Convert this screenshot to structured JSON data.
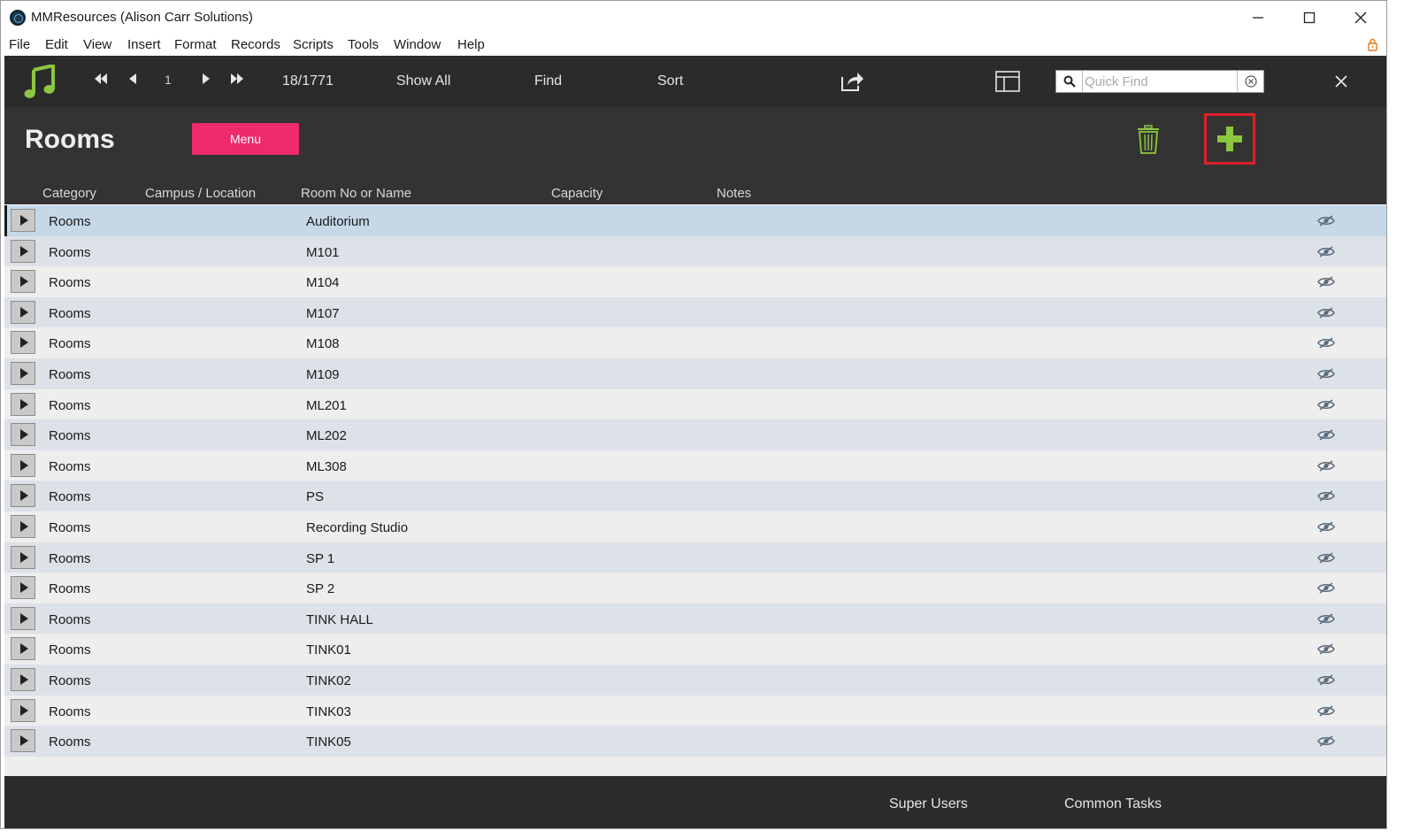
{
  "window": {
    "title": "MMResources (Alison Carr Solutions)"
  },
  "menubar": [
    "File",
    "Edit",
    "View",
    "Insert",
    "Format",
    "Records",
    "Scripts",
    "Tools",
    "Window",
    "Help"
  ],
  "toolbar": {
    "record_number": "1",
    "record_count": "18/1771",
    "show_all": "Show All",
    "find": "Find",
    "sort": "Sort",
    "quick_find_placeholder": "Quick Find"
  },
  "header": {
    "title": "Rooms",
    "menu_button": "Menu",
    "add_highlight_color": "#e0202a",
    "columns": [
      "Category",
      "Campus / Location",
      "Room No or Name",
      "Capacity",
      "Notes"
    ]
  },
  "rows": [
    {
      "category": "Rooms",
      "room": "Auditorium",
      "selected": true
    },
    {
      "category": "Rooms",
      "room": "M101"
    },
    {
      "category": "Rooms",
      "room": "M104"
    },
    {
      "category": "Rooms",
      "room": "M107"
    },
    {
      "category": "Rooms",
      "room": "M108"
    },
    {
      "category": "Rooms",
      "room": "M109"
    },
    {
      "category": "Rooms",
      "room": "ML201"
    },
    {
      "category": "Rooms",
      "room": "ML202"
    },
    {
      "category": "Rooms",
      "room": "ML308"
    },
    {
      "category": "Rooms",
      "room": "PS"
    },
    {
      "category": "Rooms",
      "room": "Recording Studio"
    },
    {
      "category": "Rooms",
      "room": "SP 1"
    },
    {
      "category": "Rooms",
      "room": "SP 2"
    },
    {
      "category": "Rooms",
      "room": "TINK HALL"
    },
    {
      "category": "Rooms",
      "room": "TINK01"
    },
    {
      "category": "Rooms",
      "room": "TINK02"
    },
    {
      "category": "Rooms",
      "room": "TINK03"
    },
    {
      "category": "Rooms",
      "room": "TINK05"
    }
  ],
  "footer": {
    "super_users": "Super Users",
    "common_tasks": "Common Tasks"
  },
  "colors": {
    "menu_button": "#ee2a6b",
    "accent_green": "#8dc63f",
    "toolbar_bg": "#2b2b2b",
    "header_bg": "#333333",
    "selected_row": "#c6d8e8"
  }
}
